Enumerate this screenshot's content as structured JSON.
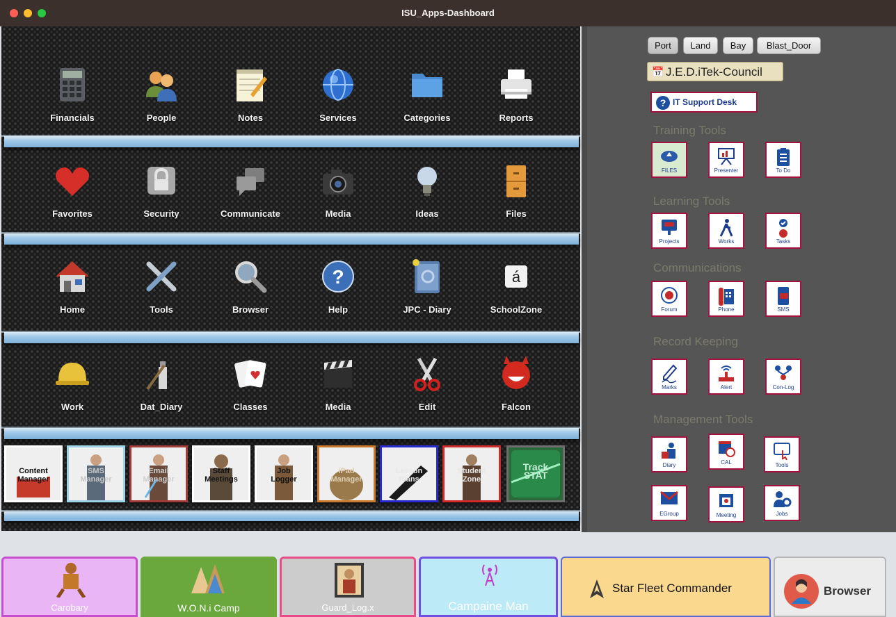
{
  "window": {
    "title": "ISU_Apps-Dashboard",
    "traffic_lights": {
      "close": "#fe5f57",
      "minimize": "#febc2e",
      "zoom": "#28c840"
    }
  },
  "shelves": [
    {
      "apps": [
        {
          "label": "Financials",
          "icon": "calculator-icon"
        },
        {
          "label": "People",
          "icon": "people-icon"
        },
        {
          "label": "Notes",
          "icon": "notepad-icon"
        },
        {
          "label": "Services",
          "icon": "globe-icon"
        },
        {
          "label": "Categories",
          "icon": "folder-icon"
        },
        {
          "label": "Reports",
          "icon": "printer-icon"
        }
      ]
    },
    {
      "apps": [
        {
          "label": "Favorites",
          "icon": "heart-icon"
        },
        {
          "label": "Security",
          "icon": "lock-icon"
        },
        {
          "label": "Communicate",
          "icon": "chat-bubbles-icon"
        },
        {
          "label": "Media",
          "icon": "camera-icon"
        },
        {
          "label": "Ideas",
          "icon": "lightbulb-icon"
        },
        {
          "label": "Files",
          "icon": "filing-cabinet-icon"
        }
      ]
    },
    {
      "apps": [
        {
          "label": "Home",
          "icon": "house-icon"
        },
        {
          "label": "Tools",
          "icon": "wrench-screwdriver-icon"
        },
        {
          "label": "Browser",
          "icon": "magnifier-icon"
        },
        {
          "label": "Help",
          "icon": "question-mark-icon"
        },
        {
          "label": "JPC - Diary",
          "icon": "address-book-icon"
        },
        {
          "label": "SchoolZone",
          "icon": "character-key-icon",
          "glyph": "á"
        }
      ]
    },
    {
      "apps": [
        {
          "label": "Work",
          "icon": "hard-hat-icon"
        },
        {
          "label": "Dat_Diary",
          "icon": "paint-tube-icon"
        },
        {
          "label": "Classes",
          "icon": "playing-cards-icon"
        },
        {
          "label": "Media",
          "icon": "clapperboard-icon"
        },
        {
          "label": "Edit",
          "icon": "scissors-icon"
        },
        {
          "label": "Falcon",
          "icon": "grinning-devil-icon"
        }
      ]
    }
  ],
  "tiles": [
    {
      "label": "Content\nManager",
      "border": "#ffffff",
      "name": "content-manager-tile"
    },
    {
      "label": "SMS\nManager",
      "border": "#9fd5e8",
      "name": "sms-manager-tile"
    },
    {
      "label": "Email\nManager",
      "border": "#a33a3a",
      "name": "email-manager-tile"
    },
    {
      "label": "Staff\nMeetings",
      "border": "#ffffff",
      "name": "staff-meetings-tile"
    },
    {
      "label": "Job\nLogger",
      "border": "#ffffff",
      "name": "job-logger-tile"
    },
    {
      "label": "iPad\nManager",
      "border": "#c97a2a",
      "name": "ipad-manager-tile"
    },
    {
      "label": "Lesson\nPlans",
      "border": "#2a2ad0",
      "name": "lesson-plans-tile"
    },
    {
      "label": "Student\nZone",
      "border": "#d02a2a",
      "name": "student-zone-tile"
    },
    {
      "label": "Track\nSTAT",
      "border": "#6e6e6e",
      "name": "track-stat-tile"
    }
  ],
  "right_panel": {
    "segments": [
      "Port",
      "Land",
      "Bay",
      "Blast_Door"
    ],
    "council_button": "J.E.D.iTek-Council",
    "support_button": "IT Support Desk",
    "sections": [
      {
        "title": "Training Tools",
        "items": [
          {
            "label": "FILES",
            "icon": "cloud-upload-icon"
          },
          {
            "label": "Presenter",
            "icon": "presentation-board-icon"
          },
          {
            "label": "To Do",
            "icon": "clipboard-list-icon"
          }
        ]
      },
      {
        "title": "Learning Tools",
        "items": [
          {
            "label": "Projects",
            "icon": "projector-icon"
          },
          {
            "label": "Works",
            "icon": "walking-person-icon"
          },
          {
            "label": "Tasks",
            "icon": "task-check-person-icon"
          }
        ]
      },
      {
        "title": "Communications",
        "items": [
          {
            "label": "Forum",
            "icon": "forum-network-icon"
          },
          {
            "label": "Phone",
            "icon": "desk-phone-icon"
          },
          {
            "label": "SMS",
            "icon": "mobile-message-icon"
          }
        ]
      },
      {
        "title": "Record Keeping",
        "items": [
          {
            "label": "Marks",
            "icon": "pen-signature-icon"
          },
          {
            "label": "Alert",
            "icon": "router-alert-icon"
          },
          {
            "label": "Con-Log",
            "icon": "people-network-icon"
          }
        ]
      },
      {
        "title": "Management Tools",
        "items": [
          {
            "label": "Diary",
            "icon": "diary-person-icon"
          },
          {
            "label": "CAL",
            "icon": "calendar-clock-icon"
          },
          {
            "label": "Tools",
            "icon": "touch-screen-icon"
          },
          {
            "label": "EGroup",
            "icon": "envelope-icon"
          },
          {
            "label": "Meeting",
            "icon": "calendar-star-icon"
          },
          {
            "label": "Jobs",
            "icon": "person-gear-icon"
          }
        ]
      }
    ]
  },
  "dock": [
    {
      "label": "Carobary",
      "bg": "#e9b5f4",
      "border": "#c64fcf",
      "icon": "warrior-figure-icon"
    },
    {
      "label": "W.O.N.i Camp",
      "bg": "#6aa83e",
      "border": "#ffffff",
      "icon": "teepee-camp-icon"
    },
    {
      "label": "Guard_Log.x",
      "bg": "#cccccc",
      "border": "#e84d8a",
      "icon": "saint-portrait-icon"
    },
    {
      "label": "Campaine Man",
      "bg": "#bdeaf7",
      "border": "#6f4ee0",
      "icon": "radio-tower-icon"
    },
    {
      "label": "Star Fleet Commander",
      "bg": "#fad88e",
      "border": "#5b6bd3",
      "icon": "starfleet-delta-icon"
    },
    {
      "label": "Browser",
      "bg": "#ececec",
      "border": "#b5b5b5",
      "icon": "reading-person-icon"
    }
  ]
}
